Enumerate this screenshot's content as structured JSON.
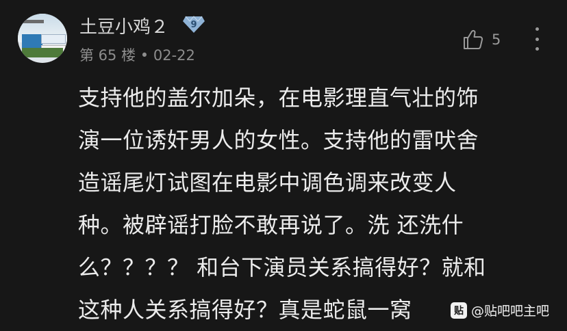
{
  "post": {
    "username": "土豆小鸡２",
    "level": "9",
    "floor": "第 65 楼",
    "separator": "•",
    "date": "02-22",
    "like_count": "5",
    "content_lines": [
      "支持他的盖尔加朵，在电影理直气壮的饰",
      "演一位诱奸男人的女性。支持他的雷吠舍",
      "造谣尾灯试图在电影中调色调来改变人",
      "种。被辟谣打脸不敢再说了。洗 还洗什",
      "么？？？？ 和台下演员关系搞得好？就和",
      "这种人关系搞得好？真是蛇鼠一窝"
    ]
  },
  "watermark": {
    "logo_char": "贴",
    "text": "@贴吧吧主吧"
  },
  "icons": {
    "level_badge": "diamond-badge-icon",
    "like": "thumb-up-icon",
    "more": "more-vertical-icon"
  },
  "colors": {
    "background": "#171717",
    "badge": "#8fb3d6"
  }
}
